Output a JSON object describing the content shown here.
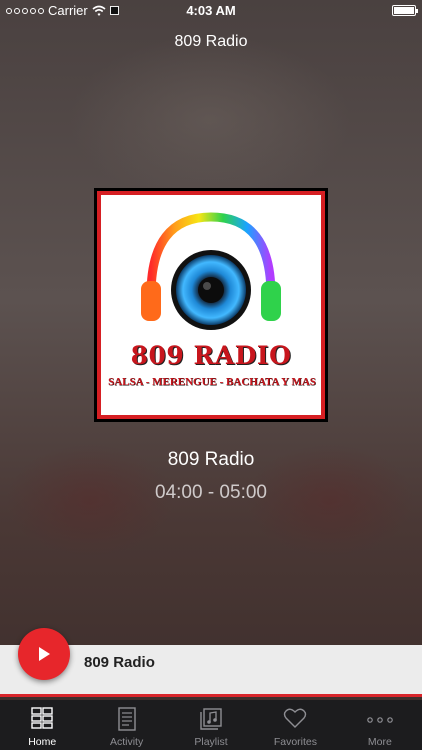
{
  "status_bar": {
    "carrier": "Carrier",
    "time": "4:03 AM"
  },
  "nav": {
    "title": "809 Radio"
  },
  "artwork": {
    "logo_title": "809 RADIO",
    "logo_tagline": "SALSA - MERENGUE - BACHATA Y MAS"
  },
  "now_playing": {
    "station": "809 Radio",
    "schedule": "04:00 - 05:00"
  },
  "mini_player": {
    "title": "809 Radio"
  },
  "tabs": [
    {
      "label": "Home",
      "icon": "grid-icon",
      "active": true
    },
    {
      "label": "Activity",
      "icon": "document-icon",
      "active": false
    },
    {
      "label": "Playlist",
      "icon": "music-icon",
      "active": false
    },
    {
      "label": "Favorites",
      "icon": "heart-icon",
      "active": false
    },
    {
      "label": "More",
      "icon": "more-icon",
      "active": false
    }
  ],
  "colors": {
    "accent": "#e7262b",
    "tab_bar": "#1c1c1e",
    "mini_player_bg": "#ececec"
  }
}
